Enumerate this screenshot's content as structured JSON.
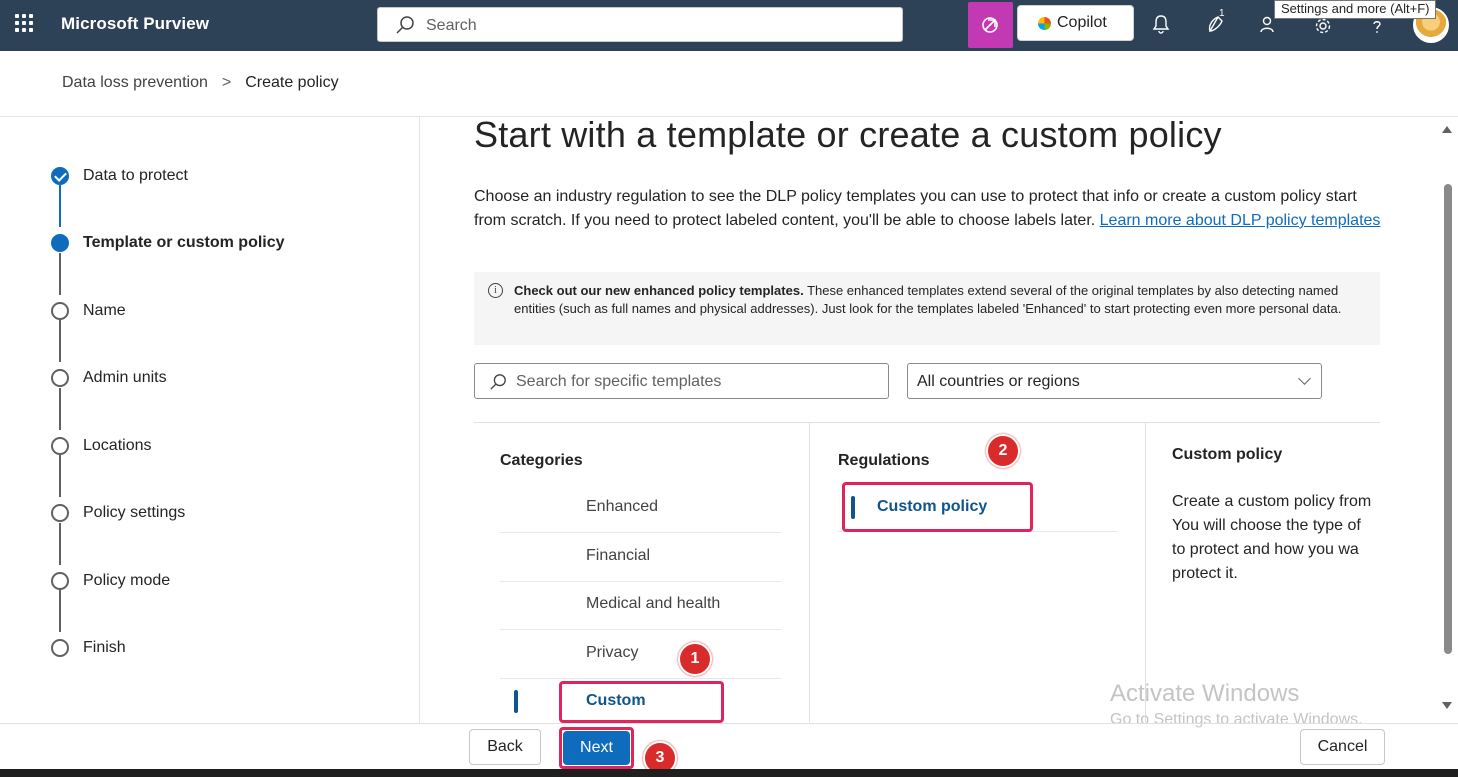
{
  "topbar": {
    "app_title": "Microsoft Purview",
    "search_placeholder": "Search",
    "copilot_label": "Copilot",
    "notification_badge": "1",
    "tooltip": "Settings and more (Alt+F)",
    "icons": [
      "app-launcher-icon",
      "search-icon",
      "copilot-icon",
      "bell-icon",
      "tips-icon",
      "people-icon",
      "gear-icon",
      "help-icon"
    ]
  },
  "breadcrumb": {
    "items": [
      "Data loss prevention",
      "Create policy"
    ],
    "separator": ">"
  },
  "stepper": {
    "steps": [
      {
        "label": "Data to protect",
        "state": "done"
      },
      {
        "label": "Template or custom policy",
        "state": "current"
      },
      {
        "label": "Name",
        "state": "todo"
      },
      {
        "label": "Admin units",
        "state": "todo"
      },
      {
        "label": "Locations",
        "state": "todo"
      },
      {
        "label": "Policy settings",
        "state": "todo"
      },
      {
        "label": "Policy mode",
        "state": "todo"
      },
      {
        "label": "Finish",
        "state": "todo"
      }
    ]
  },
  "main": {
    "title": "Start with a template or create a custom policy",
    "intro_text": "Choose an industry regulation to see the DLP policy templates you can use to protect that info or create a custom policy start from scratch. If you need to protect labeled content, you'll be able to choose labels later. ",
    "intro_link": "Learn more about DLP policy templates",
    "info_bold": "Check out our new enhanced policy templates.",
    "info_text": " These enhanced templates extend several of the original templates by also detecting named entities (such as full names and physical addresses). Just look for the templates labeled 'Enhanced' to start protecting even more personal data.",
    "template_search_placeholder": "Search for specific templates",
    "region_select_value": "All countries or regions"
  },
  "panels": {
    "categories_header": "Categories",
    "categories": [
      "Enhanced",
      "Financial",
      "Medical and health",
      "Privacy",
      "Custom"
    ],
    "selected_category": "Custom",
    "regulations_header": "Regulations",
    "regulations": [
      "Custom policy"
    ],
    "detail_title": "Custom policy",
    "detail_lines": [
      "Create a custom policy from",
      "You will choose the type of",
      "to protect and how you wa",
      "protect it."
    ]
  },
  "annotations": {
    "markers": [
      "1",
      "2",
      "3"
    ],
    "highlight_color": "#e0245e",
    "marker_color": "#d92b2b"
  },
  "watermark": {
    "line1": "Activate Windows",
    "line2": "Go to Settings to activate Windows."
  },
  "footer": {
    "back_label": "Back",
    "next_label": "Next",
    "cancel_label": "Cancel"
  },
  "colors": {
    "topbar": "#2d4256",
    "accent": "#0f6cbd",
    "copilot_tile": "#c239b3"
  }
}
